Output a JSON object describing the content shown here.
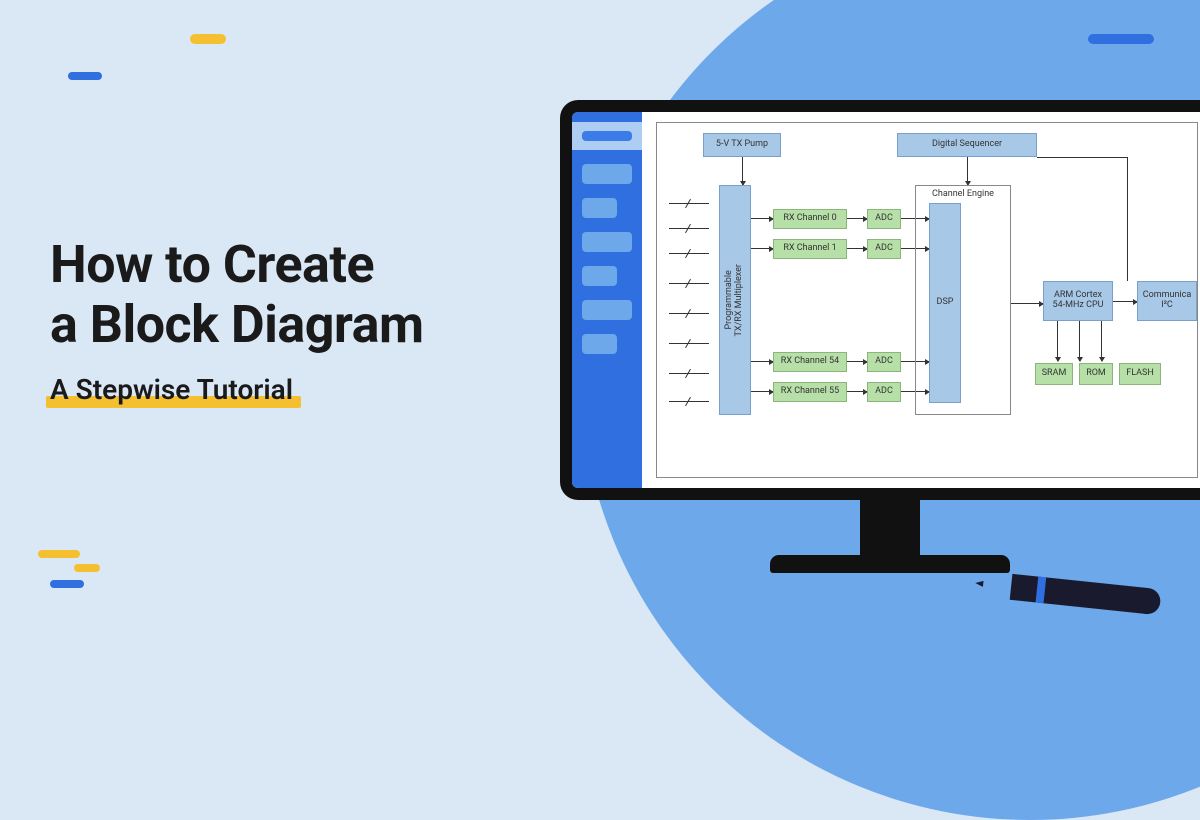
{
  "hero": {
    "title_l1": "How to Create",
    "title_l2": "a Block Diagram",
    "subtitle": "A Stepwise Tutorial"
  },
  "diagram": {
    "tx_pump": "5-V TX Pump",
    "sequencer": "Digital Sequencer",
    "mux": "Programmable\nTX/RX Multiplexer",
    "rx0": "RX Channel 0",
    "rx1": "RX Channel 1",
    "rx54": "RX Channel 54",
    "rx55": "RX Channel 55",
    "adc": "ADC",
    "channel_engine": "Channel Engine",
    "dsp": "DSP",
    "cpu": "ARM Cortex\n54-MHz CPU",
    "comm": "Communica\nI²C",
    "sram": "SRAM",
    "rom": "ROM",
    "flash": "FLASH"
  }
}
